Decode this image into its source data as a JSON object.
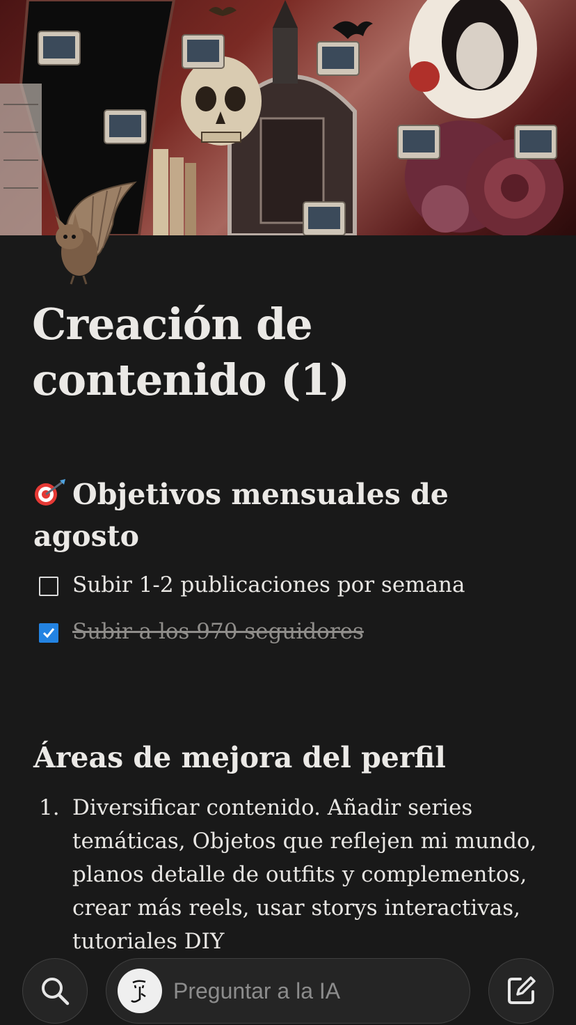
{
  "page": {
    "title": "Creación de contenido (1)"
  },
  "goals": {
    "heading": "Objetivos mensuales de agosto",
    "todos": [
      {
        "text": "Subir 1-2 publicaciones por semana",
        "checked": false
      },
      {
        "text": "Subir a los 970 seguidores",
        "checked": true
      }
    ]
  },
  "areas": {
    "heading": "Áreas de mejora del perfil",
    "items": [
      {
        "number": "1.",
        "text": "Diversificar contenido. Añadir series temáticas, Objetos que reflejen mi mundo, planos detalle de outfits y complementos, crear más reels, usar storys interactivas, tutoriales DIY"
      }
    ]
  },
  "bottom_bar": {
    "search_icon": "search-icon",
    "ai_placeholder": "Preguntar a la IA",
    "compose_icon": "compose-icon"
  },
  "colors": {
    "background": "#191919",
    "checkbox_checked": "#2383e2",
    "text": "#e8e6e3",
    "muted_text": "#8f8d8a"
  }
}
